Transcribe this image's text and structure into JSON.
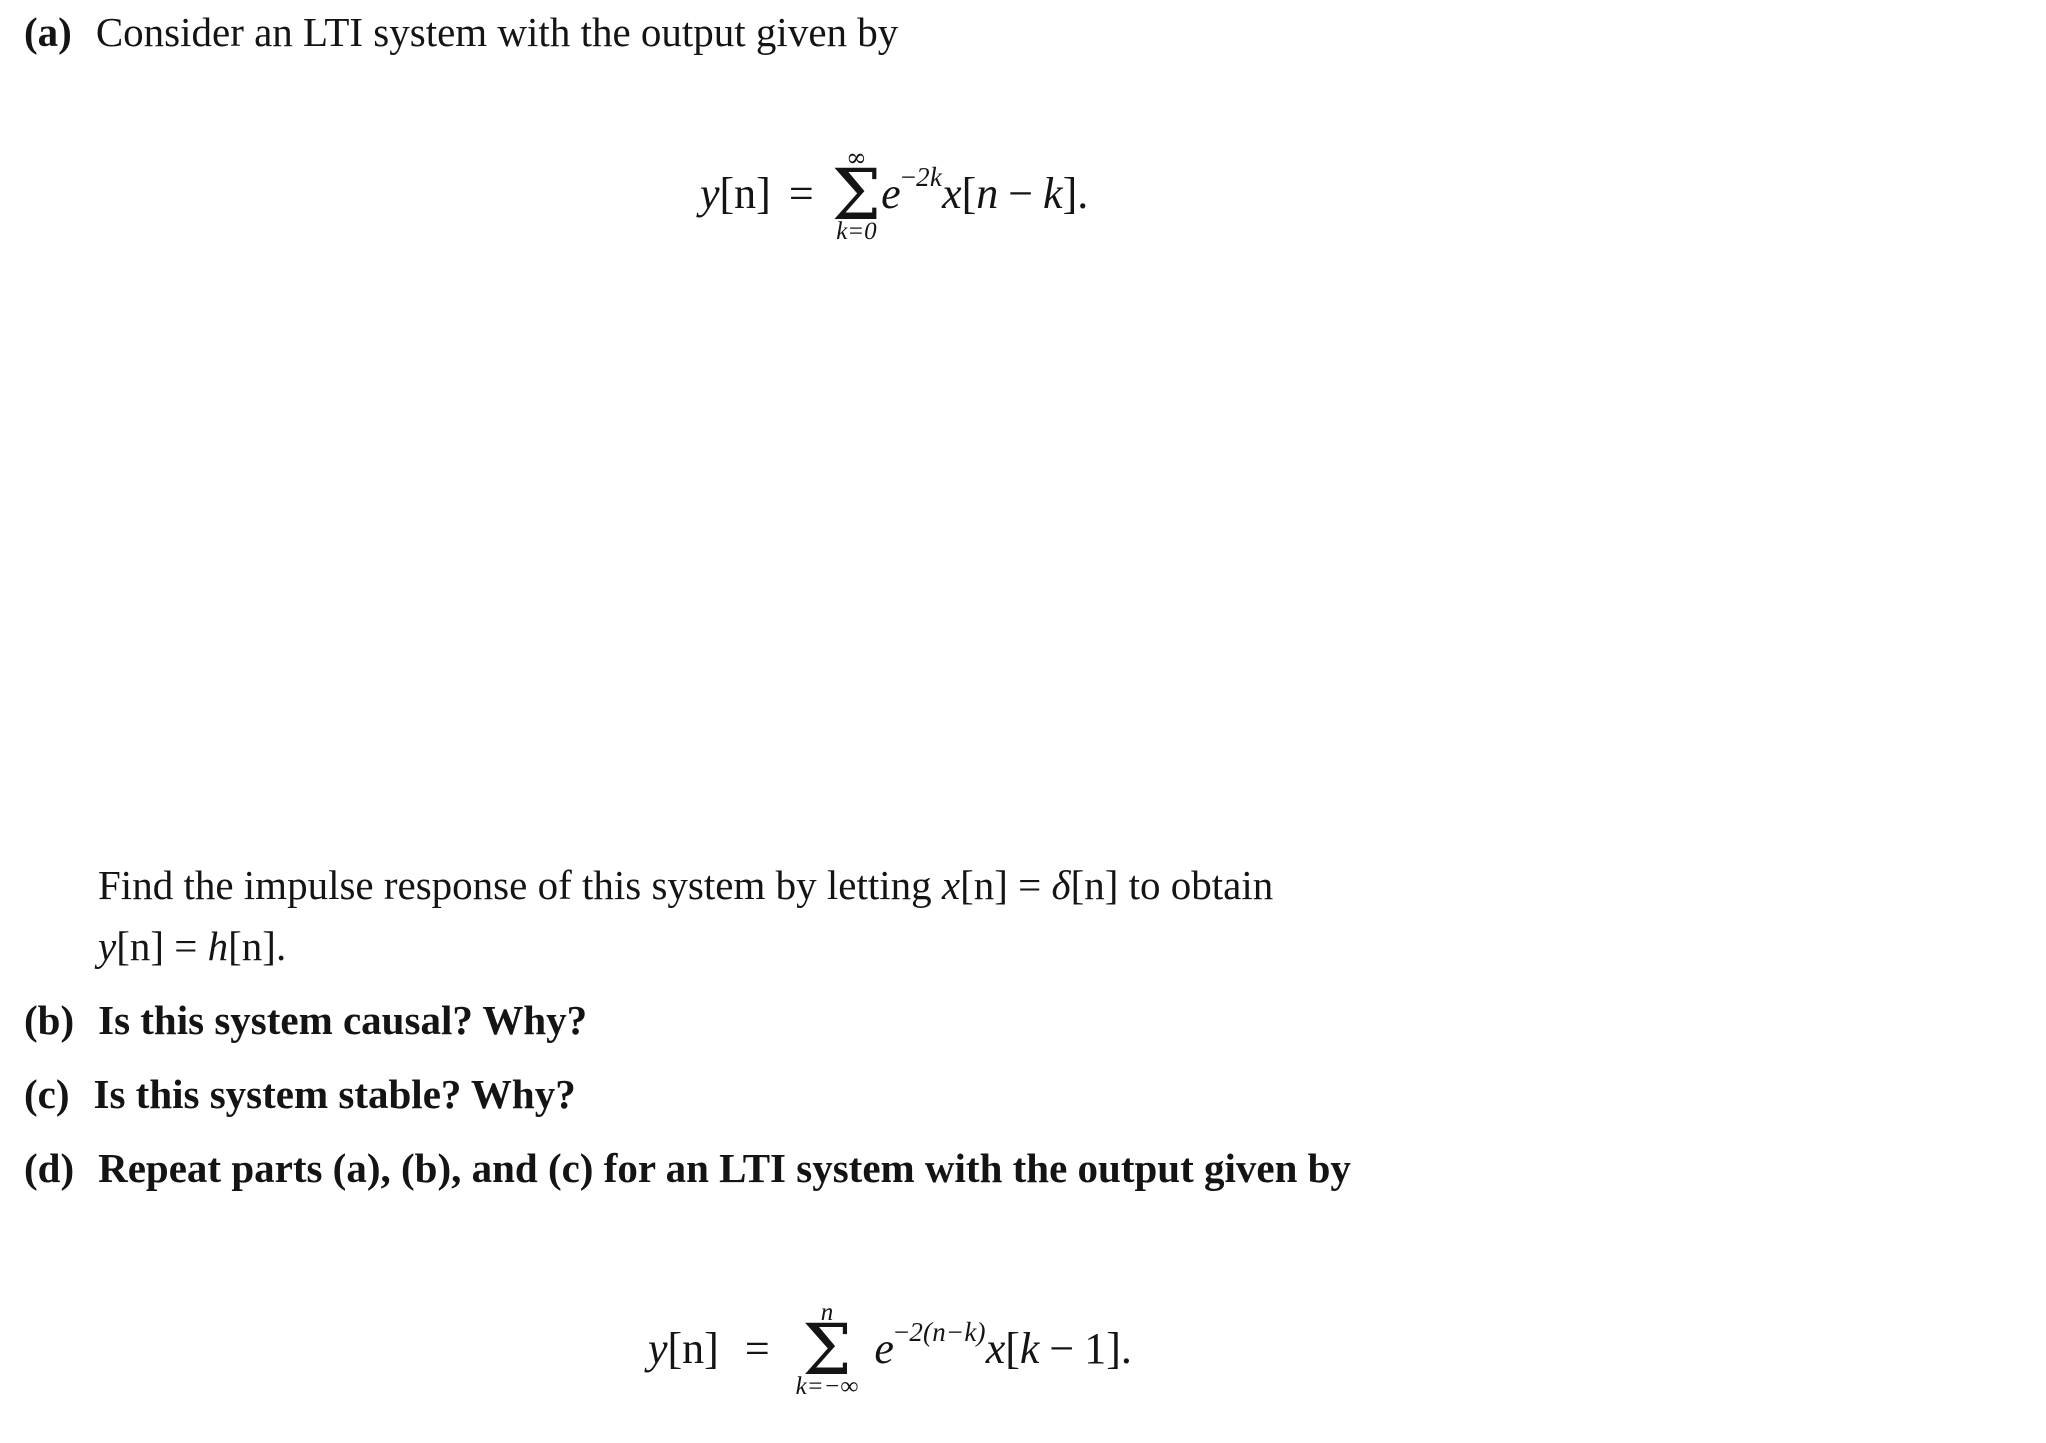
{
  "document": {
    "type": "textbook-problem",
    "background_color": "#ffffff",
    "text_color": "#141414"
  },
  "parts": [
    {
      "label": "(a)",
      "text": "Consider an LTI system with the output given by"
    },
    {
      "label": "(b)",
      "text": "Is this system causal? Why?"
    },
    {
      "label": "(c)",
      "text": "Is this system stable? Why?"
    },
    {
      "label": "(d)",
      "text": "Repeat parts (a), (b), and (c) for an LTI system with the output given by"
    }
  ],
  "paragraph": {
    "line1_a": "Find  the  impulse  response  of  this  system  by  letting  ",
    "line1_math1_lhs": "x",
    "line1_math1_idx": "[n]",
    "line1_eq": " = ",
    "line1_math2_lhs": "δ",
    "line1_math2_idx": "[n]",
    "line1_b": "  to  obtain",
    "line2_math1_lhs": "y",
    "line2_math1_idx": "[n]",
    "line2_eq": " = ",
    "line2_math2_lhs": "h",
    "line2_math2_idx": "[n]",
    "line2_end": "."
  },
  "equations": [
    {
      "id": "equation-1",
      "lhs_var": "y",
      "lhs_index": "[n]",
      "relation": "=",
      "sum_upper": "∞",
      "sum_lower": "k=0",
      "base": "e",
      "exponent_sign": "−",
      "exponent": "2k",
      "operand_var": "x",
      "operand_open": "[",
      "operand_arg1": "n",
      "operand_op": "−",
      "operand_arg2": "k",
      "operand_close": "]",
      "terminator": ".",
      "latex": "y[n] = \\sum_{k=0}^{\\infty} e^{-2k} x[n-k]."
    },
    {
      "id": "equation-2",
      "lhs_var": "y",
      "lhs_index": "[n]",
      "relation": "=",
      "sum_upper": "n",
      "sum_lower": "k=−∞",
      "base": "e",
      "exponent_sign": "−",
      "exponent": "2(n−k)",
      "operand_var": "x",
      "operand_open": "[",
      "operand_arg1": "k",
      "operand_op": "−",
      "operand_arg2": "1",
      "operand_close": "]",
      "terminator": ".",
      "latex": "y[n] = \\sum_{k=-\\infty}^{n} e^{-2(n-k)} x[k-1]."
    }
  ]
}
